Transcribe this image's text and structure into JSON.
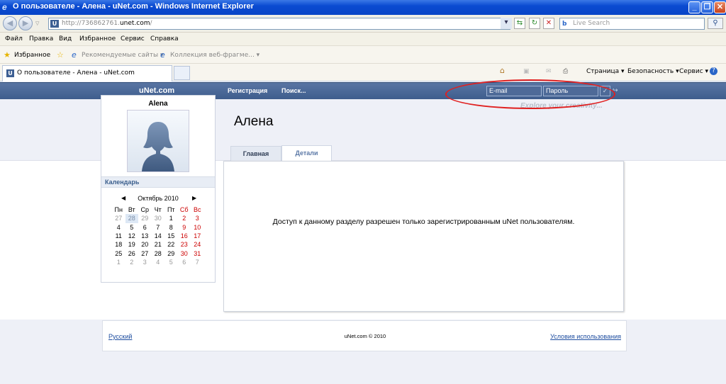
{
  "window": {
    "title": "О пользователе - Алена - uNet.com - Windows Internet Explorer"
  },
  "address": {
    "url_prefix": "http://736862761.",
    "url_domain": "unet.com",
    "url_suffix": "/"
  },
  "search": {
    "placeholder": "Live Search"
  },
  "menu": {
    "items": [
      "Файл",
      "Правка",
      "Вид",
      "Избранное",
      "Сервис",
      "Справка"
    ]
  },
  "favorites": {
    "label": "Избранное",
    "items": [
      "Рекомендуемые сайты ▾",
      "Коллекция веб-фрагме... ▾"
    ]
  },
  "tabs": {
    "active": "О пользователе - Алена - uNet.com"
  },
  "toolbar": {
    "page": "Страница ▾",
    "safety": "Безопасность ▾",
    "tools": "Сервис ▾"
  },
  "site": {
    "logo": "uNet.com",
    "nav": [
      "Регистрация",
      "Поиск..."
    ],
    "email_placeholder": "E-mail",
    "password_placeholder": "Пароль",
    "tagline": "Explore your creativity..."
  },
  "profile": {
    "name": "Alena",
    "title": "Алена"
  },
  "calendar": {
    "header": "Календарь",
    "month": "Октябрь 2010",
    "weekdays": [
      "Пн",
      "Вт",
      "Ср",
      "Чт",
      "Пт",
      "Сб",
      "Вс"
    ],
    "weeks": [
      [
        "27",
        "28",
        "29",
        "30",
        "1",
        "2",
        "3"
      ],
      [
        "4",
        "5",
        "6",
        "7",
        "8",
        "9",
        "10"
      ],
      [
        "11",
        "12",
        "13",
        "14",
        "15",
        "16",
        "17"
      ],
      [
        "18",
        "19",
        "20",
        "21",
        "22",
        "23",
        "24"
      ],
      [
        "25",
        "26",
        "27",
        "28",
        "29",
        "30",
        "31"
      ],
      [
        "1",
        "2",
        "3",
        "4",
        "5",
        "6",
        "7"
      ]
    ]
  },
  "page_tabs": {
    "main": "Главная",
    "details": "Детали"
  },
  "content": {
    "message": "Доступ к данному разделу разрешен только зарегистрированным uNet пользователям."
  },
  "footer": {
    "language": "Русский",
    "copyright": "uNet.com © 2010",
    "terms": "Условия использования"
  }
}
